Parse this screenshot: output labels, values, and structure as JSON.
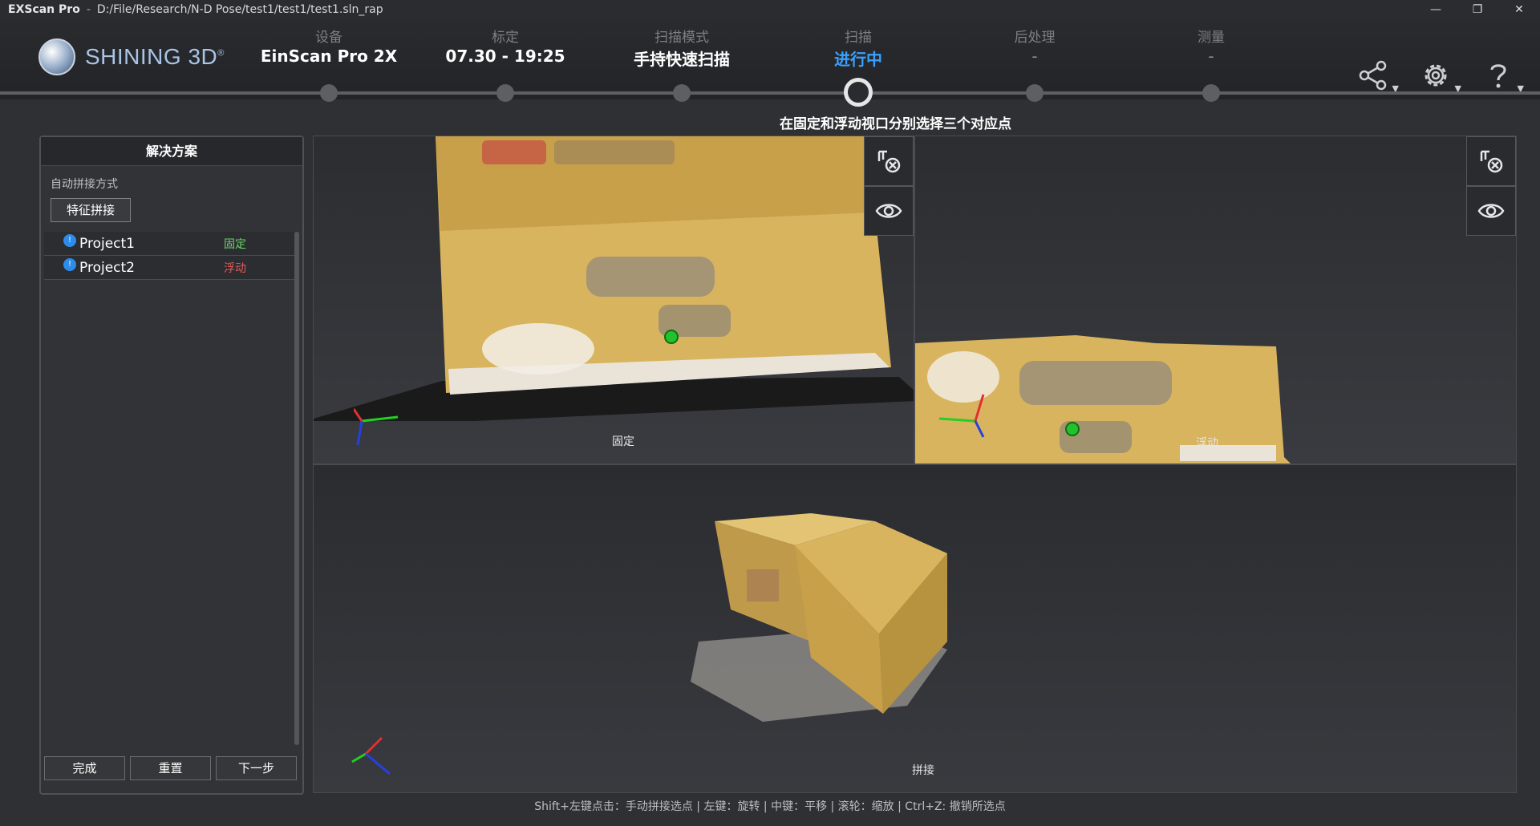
{
  "window": {
    "app_name": "EXScan Pro",
    "separator": "-",
    "path": "D:/File/Research/N-D Pose/test1/test1/test1.sln_rap",
    "minimize": "—",
    "restore": "❐",
    "close": "✕"
  },
  "logo": {
    "text": "SHINING 3D",
    "reg": "®"
  },
  "steps": [
    {
      "caption": "设备",
      "value": "EinScan Pro 2X"
    },
    {
      "caption": "标定",
      "value": "07.30 - 19:25"
    },
    {
      "caption": "扫描模式",
      "value": "手持快速扫描"
    },
    {
      "caption": "扫描",
      "value": "进行中"
    },
    {
      "caption": "后处理",
      "value": "-"
    },
    {
      "caption": "测量",
      "value": "-"
    }
  ],
  "hint": "在固定和浮动视口分别选择三个对应点",
  "toolbar": {
    "share_icon": "share-icon",
    "settings_icon": "gear-icon",
    "help_icon": "help-icon"
  },
  "panel": {
    "title": "解决方案",
    "subtitle": "自动拼接方式",
    "feature_button": "特征拼接",
    "projects": [
      {
        "name": "Project1",
        "tag": "固定"
      },
      {
        "name": "Project2",
        "tag": "浮动"
      }
    ],
    "actions": {
      "done": "完成",
      "reset": "重置",
      "next": "下一步"
    }
  },
  "viewports": {
    "fixed_label": "固定",
    "float_label": "浮动",
    "merge_label": "拼接"
  },
  "footer_hint": "Shift+左键点击：手动拼接选点 | 左键：旋转 | 中键：平移 | 滚轮：缩放 | Ctrl+Z: 撤销所选点",
  "colors": {
    "accent": "#3aa0ff",
    "fixed_tag": "#6bd36b",
    "float_tag": "#e05b5b",
    "picked_point": "#22c32a"
  }
}
